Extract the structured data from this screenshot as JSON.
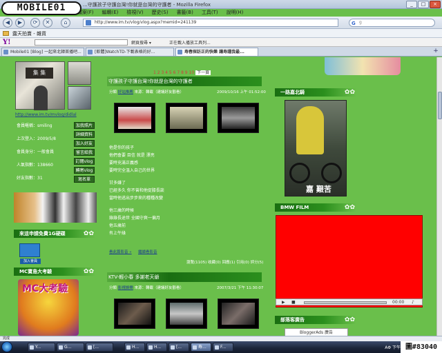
{
  "logo": {
    "text": "MOBILE01"
  },
  "window": {
    "title": "...守護孩子守護台灣!你就是台灣的守護者 - Mozilla Firefox",
    "minimize": "_",
    "maximize": "□",
    "close": "×"
  },
  "menu": [
    "檔案(F)",
    "編輯(E)",
    "檢視(V)",
    "歷史(S)",
    "書籤(B)",
    "工具(T)",
    "說明(H)"
  ],
  "nav": {
    "back": "◀",
    "forward": "▶",
    "reload": "⟳",
    "stop": "✕",
    "home": "⌂",
    "url": "http://www.im.tv/vlog/vlog.aspx?memid=241139",
    "search_value": "g",
    "search_placeholder": "Google"
  },
  "bookmarks": {
    "item": "露天拍賣 - 雜貨"
  },
  "yahoo_toolbar": {
    "logo": "Y!",
    "item1": "網頁搜尋 ▾",
    "item2": "正在載入播放工具列..."
  },
  "tabs": [
    {
      "label": "Mobile01 [Blog] 一起來北韓首播吧..."
    },
    {
      "label": "[軟體]WatchTD-下載表格的好..."
    },
    {
      "label": "寿春探訪正的快樂 讓寿謹我最..."
    }
  ],
  "tab_new": "+",
  "left": {
    "url": "http://www.im.tv/mvlog/didlal",
    "stats": [
      "會員暱稱：smiling",
      "上次登入：2009/5/8",
      "會員身分：一般會員",
      "人氣指數：138660",
      "好友指數：31"
    ],
    "buttons": [
      "加我照片",
      "詳細資料",
      "加入好友",
      "留言給我",
      "訂閱vlog",
      "轉寄vlog",
      "寫名單"
    ],
    "section1": "來這申請免費1G硬碟",
    "join_label": "加入會員",
    "section2": "MC寶島大考驗",
    "banner_text": "MC大考驗"
  },
  "pager": {
    "pages": "1 2 3 4 5 6 7 8 9 10",
    "current": "下一頁"
  },
  "posts": [
    {
      "title": "守護孩子守護台灣!你就是台灣的守護者",
      "meta_prefix": "分類",
      "category": "好站推薦",
      "source_label": "來源：轉載（建議好友觀看）",
      "date": "2009/10/16 上午 01:52:00"
    },
    {
      "title": "KTV-輕小春 多謝老天爺",
      "meta_prefix": "分類",
      "category": "影視娛樂",
      "source_label": "來源：轉載（建議好友觀看）",
      "date": "2007/3/21 下午 11:30:07"
    }
  ],
  "poem": [
    "他是你的孩子",
    "他們會要 目信 就是 漂亮",
    "要時充滿正義感",
    "要時完全溫入自己的世界",
    "",
    "甘多嫌了",
    "已經多久 你不曾和他促膝長談",
    "當時他逃出步步來的種種改變",
    "",
    "他三歲的時候",
    "錄錄長途世 全國守爽一偏月",
    "他五歲前",
    "有上午綠"
  ],
  "post_links": {
    "more": "看此篇影音 »",
    "comments": "繼續看影音"
  },
  "post_stats": "瀏覽(1105) 收藏(0) 回應(1) 引用(0) 評分(5)",
  "right": {
    "section1": "一路嘉北騎",
    "bike_caption": "嘉 艱苦",
    "section2": "BMW FILM",
    "player_time": "00:00",
    "section3": "部落客廣告",
    "ads_label": "BloggerAds 廣告"
  },
  "statusbar": "完成",
  "taskbar": {
    "items": [
      "Y...",
      "G...",
      "[...",
      "H...",
      "H...",
      "[...",
      "寿...",
      "F..."
    ],
    "tray": "ΑΦ  下午"
  },
  "watermark": "圖#83040"
}
